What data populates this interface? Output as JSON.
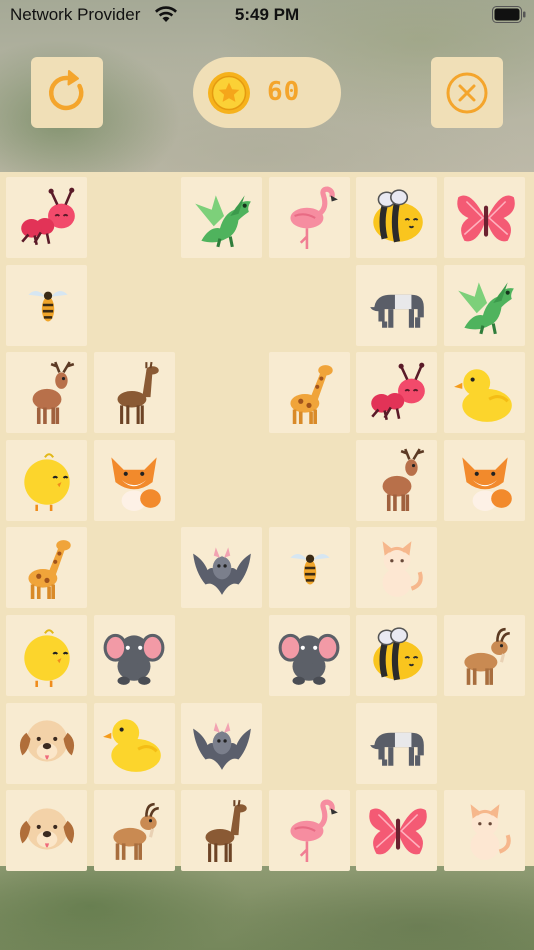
{
  "status_bar": {
    "carrier": "Network Provider",
    "time": "5:49 PM"
  },
  "header": {
    "coins": "60"
  },
  "colors": {
    "accent_orange": "#f4a52c",
    "button_bg": "#f0dfb7",
    "tile_bg": "#f8ebd1",
    "board_bg": "#f1e2bd"
  },
  "board": {
    "columns": 6,
    "rows": 8,
    "tiles": [
      {
        "row": 0,
        "col": 0,
        "animal": "ant"
      },
      {
        "row": 0,
        "col": 2,
        "animal": "dragon"
      },
      {
        "row": 0,
        "col": 3,
        "animal": "flamingo"
      },
      {
        "row": 0,
        "col": 4,
        "animal": "bee"
      },
      {
        "row": 0,
        "col": 5,
        "animal": "butterfly"
      },
      {
        "row": 1,
        "col": 0,
        "animal": "wasp"
      },
      {
        "row": 1,
        "col": 4,
        "animal": "tapir"
      },
      {
        "row": 1,
        "col": 5,
        "animal": "dragon"
      },
      {
        "row": 2,
        "col": 0,
        "animal": "deer"
      },
      {
        "row": 2,
        "col": 1,
        "animal": "llama"
      },
      {
        "row": 2,
        "col": 3,
        "animal": "giraffe"
      },
      {
        "row": 2,
        "col": 4,
        "animal": "ant"
      },
      {
        "row": 2,
        "col": 5,
        "animal": "duck"
      },
      {
        "row": 3,
        "col": 0,
        "animal": "chick"
      },
      {
        "row": 3,
        "col": 1,
        "animal": "fox"
      },
      {
        "row": 3,
        "col": 4,
        "animal": "deer"
      },
      {
        "row": 3,
        "col": 5,
        "animal": "fox"
      },
      {
        "row": 4,
        "col": 0,
        "animal": "giraffe"
      },
      {
        "row": 4,
        "col": 2,
        "animal": "bat"
      },
      {
        "row": 4,
        "col": 3,
        "animal": "wasp"
      },
      {
        "row": 4,
        "col": 4,
        "animal": "cat"
      },
      {
        "row": 5,
        "col": 0,
        "animal": "chick"
      },
      {
        "row": 5,
        "col": 1,
        "animal": "elephant"
      },
      {
        "row": 5,
        "col": 3,
        "animal": "elephant"
      },
      {
        "row": 5,
        "col": 4,
        "animal": "bee"
      },
      {
        "row": 5,
        "col": 5,
        "animal": "goat"
      },
      {
        "row": 6,
        "col": 0,
        "animal": "dog"
      },
      {
        "row": 6,
        "col": 1,
        "animal": "duck"
      },
      {
        "row": 6,
        "col": 2,
        "animal": "bat"
      },
      {
        "row": 6,
        "col": 4,
        "animal": "tapir"
      },
      {
        "row": 7,
        "col": 0,
        "animal": "dog"
      },
      {
        "row": 7,
        "col": 1,
        "animal": "goat"
      },
      {
        "row": 7,
        "col": 2,
        "animal": "llama"
      },
      {
        "row": 7,
        "col": 3,
        "animal": "flamingo"
      },
      {
        "row": 7,
        "col": 4,
        "animal": "butterfly"
      },
      {
        "row": 7,
        "col": 5,
        "animal": "cat"
      }
    ]
  }
}
